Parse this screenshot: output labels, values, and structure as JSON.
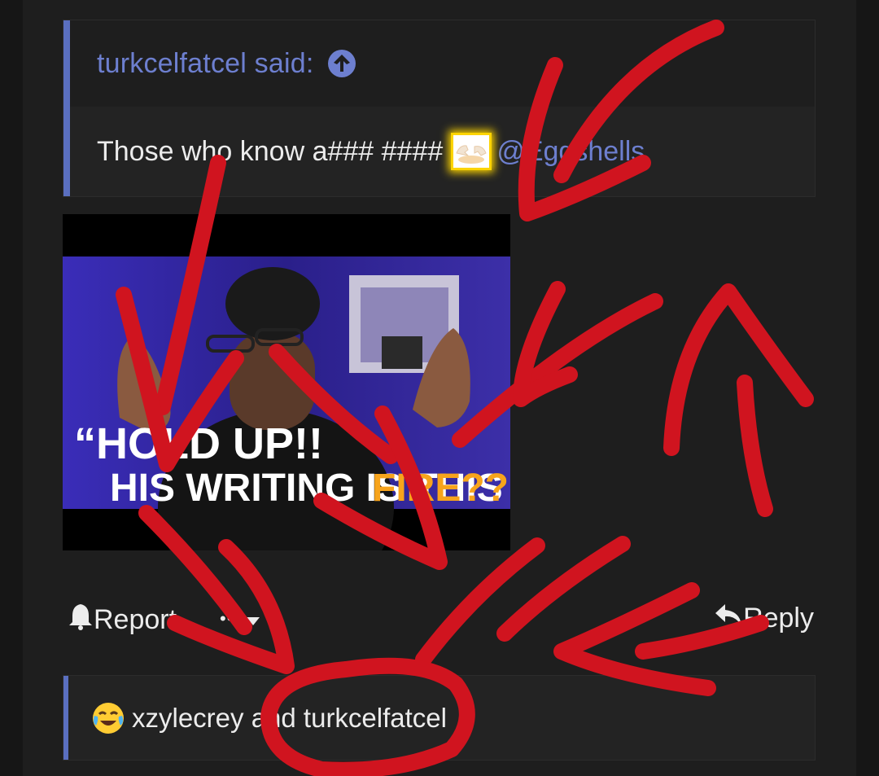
{
  "quote": {
    "author": "turkcelfatcel said:",
    "text_before": "Those who know a### ####",
    "mention": "@Eggshells"
  },
  "image": {
    "caption_line1": "“HOLD UP!!",
    "caption_line2_white": "HIS WRITING IS THIS",
    "caption_line2_orange": "FIRE???”"
  },
  "actions": {
    "report_label": "Report",
    "more_label": "•••",
    "reply_label": "Reply"
  },
  "reactions": {
    "users_text": "xzylecrey and turkcelfatcel"
  },
  "icons": {
    "up": "arrow-up-circle-icon",
    "bell": "bell-icon",
    "reply": "reply-arrow-icon",
    "emoji_reaction": "crying-laughing-emoji",
    "egg": "cracked-egg-emoji"
  },
  "colors": {
    "background": "#1e1e1e",
    "accent": "#6d7fcf",
    "annotation": "#d0141f",
    "highlight": "#f7a41c"
  }
}
